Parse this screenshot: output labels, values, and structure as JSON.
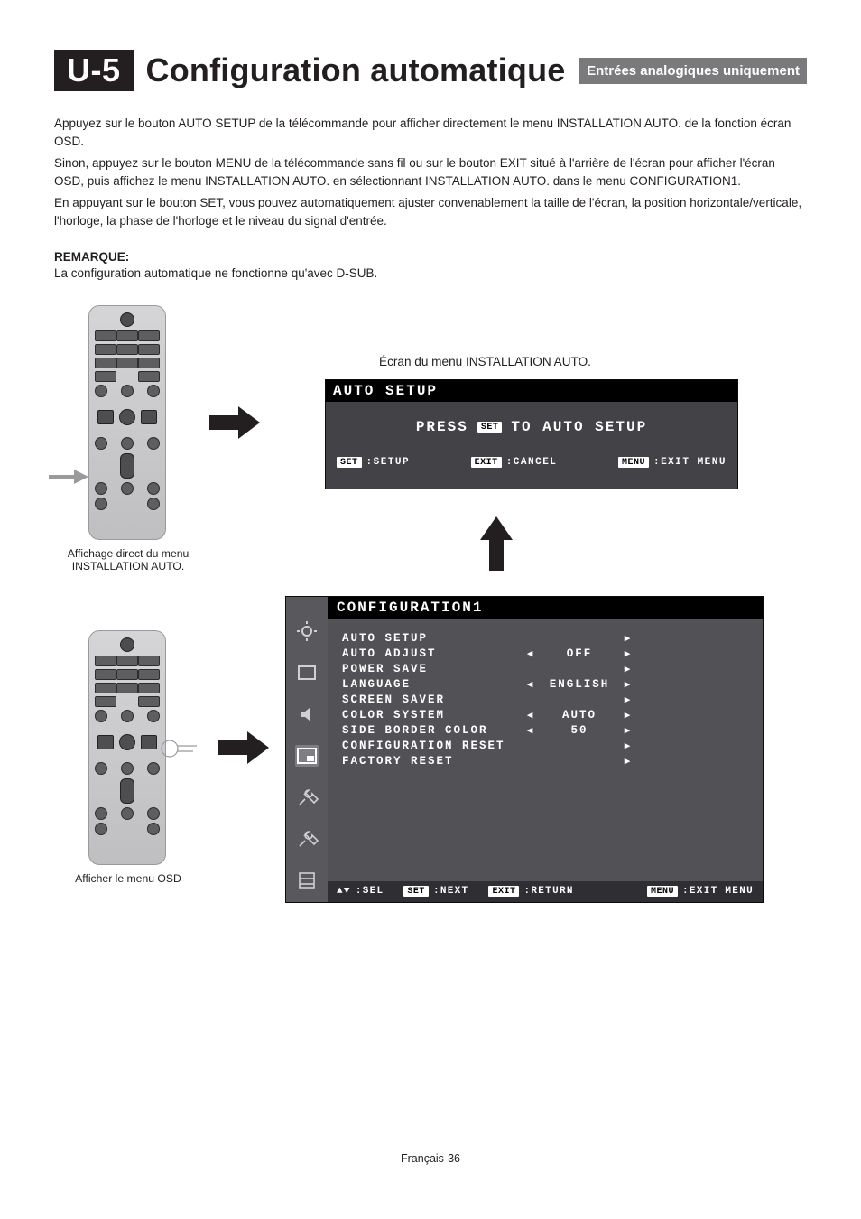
{
  "header": {
    "section_code": "U-5",
    "title": "Configuration automatique",
    "badge": "Entrées analogiques uniquement"
  },
  "paragraphs": {
    "p1": "Appuyez sur le bouton AUTO SETUP de la télécommande pour afficher directement le menu INSTALLATION AUTO. de la fonction écran OSD.",
    "p2": "Sinon, appuyez sur le bouton MENU de la télécommande sans fil ou sur le bouton EXIT situé à l'arrière de l'écran pour afficher l'écran OSD, puis affichez le menu INSTALLATION AUTO. en sélectionnant INSTALLATION AUTO. dans le menu CONFIGURATION1.",
    "p3": "En appuyant sur le bouton SET, vous pouvez automatiquement ajuster convenablement la taille de l'écran, la position horizontale/verticale, l'horloge, la phase de l'horloge et le niveau du signal d'entrée."
  },
  "remarque": {
    "label": "REMARQUE:",
    "text": "La configuration automatique ne fonctionne qu'avec D-SUB."
  },
  "captions": {
    "remote1": "Affichage direct du menu INSTALLATION AUTO.",
    "remote2": "Afficher le menu OSD",
    "osd_title": "Écran du menu INSTALLATION AUTO."
  },
  "osd_auto": {
    "header": "AUTO SETUP",
    "press_left": "PRESS",
    "press_key": "SET",
    "press_right": "TO AUTO SETUP",
    "foot_set_key": "SET",
    "foot_set_label": ":SETUP",
    "foot_exit_key": "EXIT",
    "foot_exit_label": ":CANCEL",
    "foot_menu_key": "MENU",
    "foot_menu_label": ":EXIT MENU"
  },
  "osd_conf": {
    "header": "CONFIGURATION1",
    "items": [
      {
        "name": "AUTO SETUP",
        "left": "",
        "value": "",
        "right": "▶"
      },
      {
        "name": "AUTO ADJUST",
        "left": "◀",
        "value": "OFF",
        "right": "▶"
      },
      {
        "name": "POWER SAVE",
        "left": "",
        "value": "",
        "right": "▶"
      },
      {
        "name": "LANGUAGE",
        "left": "◀",
        "value": "ENGLISH",
        "right": "▶"
      },
      {
        "name": "SCREEN SAVER",
        "left": "",
        "value": "",
        "right": "▶"
      },
      {
        "name": "COLOR SYSTEM",
        "left": "◀",
        "value": "AUTO",
        "right": "▶"
      },
      {
        "name": "SIDE BORDER COLOR",
        "left": "◀",
        "value": "50",
        "right": "▶"
      },
      {
        "name": "CONFIGURATION RESET",
        "left": "",
        "value": "",
        "right": "▶"
      },
      {
        "name": "FACTORY RESET",
        "left": "",
        "value": "",
        "right": "▶"
      }
    ],
    "foot_sel_icon": "▲▼",
    "foot_sel_label": ":SEL",
    "foot_set_key": "SET",
    "foot_set_label": ":NEXT",
    "foot_exit_key": "EXIT",
    "foot_exit_label": ":RETURN",
    "foot_menu_key": "MENU",
    "foot_menu_label": ":EXIT MENU"
  },
  "page_number": "Français-36"
}
